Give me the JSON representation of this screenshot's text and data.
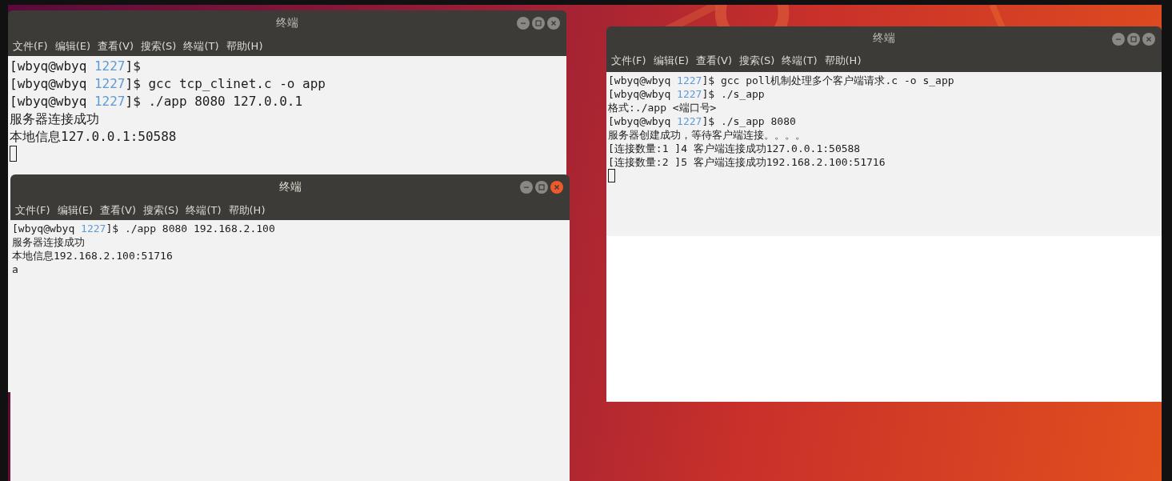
{
  "windows": [
    {
      "title": "终端",
      "active": false,
      "menu": [
        "文件(F)",
        "编辑(E)",
        "查看(V)",
        "搜索(S)",
        "终端(T)",
        "帮助(H)"
      ],
      "lines": [
        {
          "kind": "prompt",
          "prefix": "[wbyq@wbyq",
          "dir": "1227",
          "suffix": "]$"
        },
        {
          "kind": "prompt",
          "prefix": "[wbyq@wbyq",
          "dir": "1227",
          "suffix": "]$",
          "command": "gcc tcp_clinet.c -o app"
        },
        {
          "kind": "prompt",
          "prefix": "[wbyq@wbyq",
          "dir": "1227",
          "suffix": "]$",
          "command": "./app 8080 127.0.0.1"
        },
        {
          "kind": "output",
          "text": "服务器连接成功"
        },
        {
          "kind": "output",
          "text": "本地信息127.0.0.1:50588"
        },
        {
          "kind": "cursor"
        }
      ]
    },
    {
      "title": "终端",
      "active": true,
      "menu": [
        "文件(F)",
        "编辑(E)",
        "查看(V)",
        "搜索(S)",
        "终端(T)",
        "帮助(H)"
      ],
      "lines": [
        {
          "kind": "prompt",
          "prefix": "[wbyq@wbyq",
          "dir": "1227",
          "suffix": "]$",
          "command": "./app 8080 192.168.2.100"
        },
        {
          "kind": "output",
          "text": "服务器连接成功"
        },
        {
          "kind": "output",
          "text": "本地信息192.168.2.100:51716"
        },
        {
          "kind": "output",
          "text": "a"
        }
      ]
    },
    {
      "title": "终端",
      "active": false,
      "menu": [
        "文件(F)",
        "编辑(E)",
        "查看(V)",
        "搜索(S)",
        "终端(T)",
        "帮助(H)"
      ],
      "lines": [
        {
          "kind": "prompt",
          "prefix": "[wbyq@wbyq",
          "dir": "1227",
          "suffix": "]$",
          "command": "gcc poll机制处理多个客户端请求.c -o s_app"
        },
        {
          "kind": "prompt",
          "prefix": "[wbyq@wbyq",
          "dir": "1227",
          "suffix": "]$",
          "command": "./s_app"
        },
        {
          "kind": "output",
          "text": "格式:./app <端口号>"
        },
        {
          "kind": "prompt",
          "prefix": "[wbyq@wbyq",
          "dir": "1227",
          "suffix": "]$",
          "command": "./s_app 8080"
        },
        {
          "kind": "output",
          "text": "服务器创建成功，等待客户端连接。。。。"
        },
        {
          "kind": "output",
          "text": "[连接数量:1 ]4 客户端连接成功127.0.0.1:50588"
        },
        {
          "kind": "output",
          "text": "[连接数量:2 ]5 客户端连接成功192.168.2.100:51716"
        },
        {
          "kind": "cursor"
        }
      ]
    }
  ]
}
